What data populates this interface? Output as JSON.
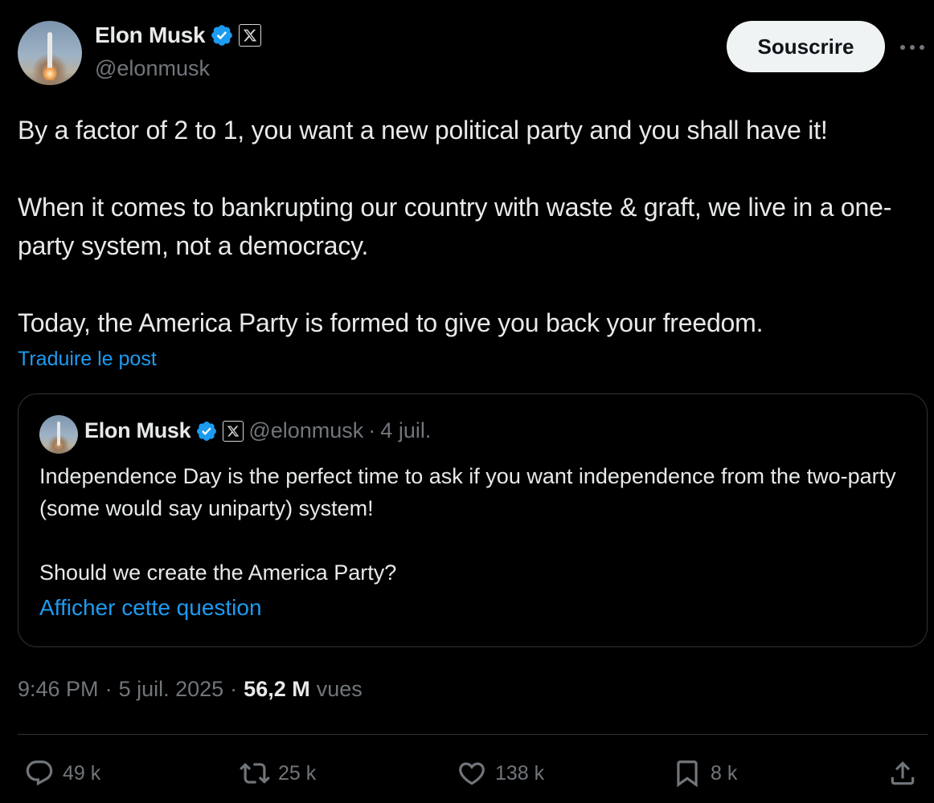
{
  "author": {
    "name": "Elon Musk",
    "handle": "@elonmusk"
  },
  "header": {
    "subscribe_label": "Souscrire"
  },
  "post": {
    "paragraphs": [
      "By a factor of 2 to 1, you want a new political party and you shall have it!",
      "When it comes to bankrupting our country with waste & graft, we live in a one-party system, not a democracy.",
      "Today, the America Party is formed to give you back your freedom."
    ],
    "translate_label": "Traduire le post",
    "time": "9:46 PM",
    "date": "5 juil. 2025",
    "views_count": "56,2 M",
    "views_label": "vues",
    "separator": "·"
  },
  "quote": {
    "name": "Elon Musk",
    "handle": "@elonmusk",
    "separator": "·",
    "date": "4 juil.",
    "paragraphs": [
      "Independence Day is the perfect time to ask if you want independence from the two-party (some would say uniparty) system!",
      "Should we create the America Party?"
    ],
    "link_label": "Afficher cette question"
  },
  "actions": {
    "replies": "49 k",
    "reposts": "25 k",
    "likes": "138 k",
    "bookmarks": "8 k"
  },
  "colors": {
    "background": "#000000",
    "text": "#e7e9ea",
    "secondary": "#71767b",
    "accent": "#1d9bf0",
    "border": "#2f3336"
  },
  "icons": [
    "verified-icon",
    "x-logo-icon",
    "more-icon",
    "reply-icon",
    "repost-icon",
    "like-icon",
    "bookmark-icon",
    "share-icon"
  ]
}
